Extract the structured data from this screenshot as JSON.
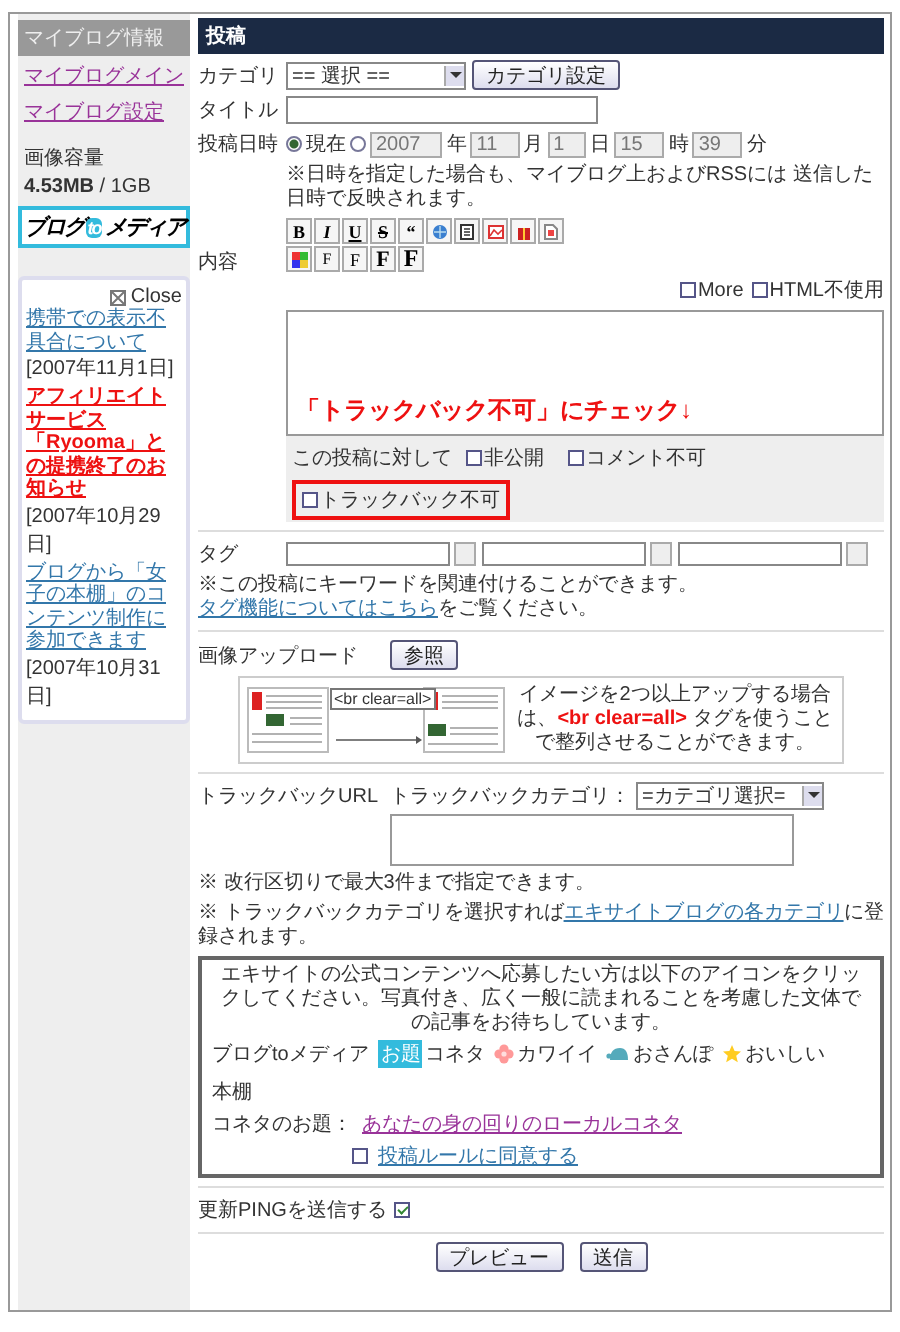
{
  "sidebar": {
    "header": "マイブログ情報",
    "links": [
      "マイブログメイン",
      "マイブログ設定"
    ],
    "storage_label": "画像容量",
    "storage_used": "4.53MB",
    "storage_total": " / 1GB",
    "logo": {
      "left": "ブログ",
      "mid": "to",
      "right": "メディア"
    },
    "news": {
      "close": "Close",
      "items": [
        {
          "text": "携帯での表示不具合について",
          "date": "[2007年11月1日]",
          "highlight": false
        },
        {
          "text": "アフィリエイトサービス「Ryooma」との提携終了のお知らせ",
          "date": "[2007年10月29日]",
          "highlight": true
        },
        {
          "text": "ブログから「女子の本棚」のコンテンツ制作に参加できます",
          "date": "[2007年10月31日]",
          "highlight": false
        }
      ]
    }
  },
  "main": {
    "header": "投稿",
    "category": {
      "label": "カテゴリ",
      "value": "== 選択 ==",
      "button": "カテゴリ設定"
    },
    "title": {
      "label": "タイトル"
    },
    "date": {
      "label": "投稿日時",
      "options": [
        {
          "label": "現在",
          "selected": true
        },
        {
          "selected": false
        }
      ],
      "disabled": true,
      "parts": [
        {
          "value": "2007",
          "unit": "年"
        },
        {
          "value": "11",
          "unit": "月"
        },
        {
          "value": "1",
          "unit": "日"
        },
        {
          "value": "15",
          "unit": "時"
        },
        {
          "value": "39",
          "unit": "分"
        }
      ],
      "note": "※日時を指定した場合も、マイブログ上およびRSSには 送信した日時で反映されます。"
    },
    "content": {
      "label": "内容",
      "format_buttons": [
        "B",
        "I",
        "U",
        "S",
        "“"
      ],
      "font_buttons": [
        "F",
        "F",
        "F",
        "F"
      ],
      "checkboxes": [
        {
          "label": "More",
          "checked": false
        },
        {
          "label": "HTML不使用",
          "checked": false
        }
      ],
      "annotation": "「トラックバック不可」にチェック↓",
      "options_label": "この投稿に対して",
      "options": [
        {
          "label": "非公開",
          "checked": false,
          "highlighted": false
        },
        {
          "label": "コメント不可",
          "checked": false,
          "highlighted": false
        },
        {
          "label": "トラックバック不可",
          "checked": false,
          "highlighted": true
        }
      ]
    },
    "tags": {
      "label": "タグ",
      "note_before": "※この投稿にキーワードを関連付けることができます。",
      "note_link": "タグ機能についてはこちら",
      "note_after": "をご覧ください。"
    },
    "upload": {
      "label": "画像アップロード",
      "button": "参照",
      "illustration_label": "<br clear=all>",
      "description": "イメージを2つ以上アップする場合は、**<br clear=all>** タグを使うことで整列させることができます。"
    },
    "trackback": {
      "label": "トラックバックURL",
      "category_label": "トラックバックカテゴリ：",
      "category_value": "=カテゴリ選択=",
      "note1": "※ 改行区切りで最大3件まで指定できます。",
      "note2_before": "※ トラックバックカテゴリを選択すれば",
      "note2_link": "エキサイトブログの各カテゴリ",
      "note2_after": "に登録されます。"
    },
    "media": {
      "intro": "エキサイトの公式コンテンツへ応募したい方は以下のアイコンをクリックしてください。写真付き、広く一般に読まれることを考慮した文体での記事をお待ちしています。",
      "label": "ブログtoメディア",
      "badge": "お題",
      "items": [
        {
          "kind": "koneta",
          "label": "コネタ"
        },
        {
          "kind": "kawaii",
          "label": "カワイイ"
        },
        {
          "kind": "osanpo",
          "label": "おさんぽ"
        },
        {
          "kind": "oishii",
          "label": "おいしい"
        },
        {
          "kind": "hondana",
          "label": "本棚"
        }
      ],
      "theme_label": "コネタのお題：",
      "theme_link": "あなたの身の回りのローカルコネタ",
      "agree": {
        "label": "投稿ルールに同意する",
        "checked": false
      }
    },
    "ping": {
      "label": "更新PINGを送信する",
      "checked": true
    },
    "buttons": [
      "プレビュー",
      "送信"
    ]
  }
}
